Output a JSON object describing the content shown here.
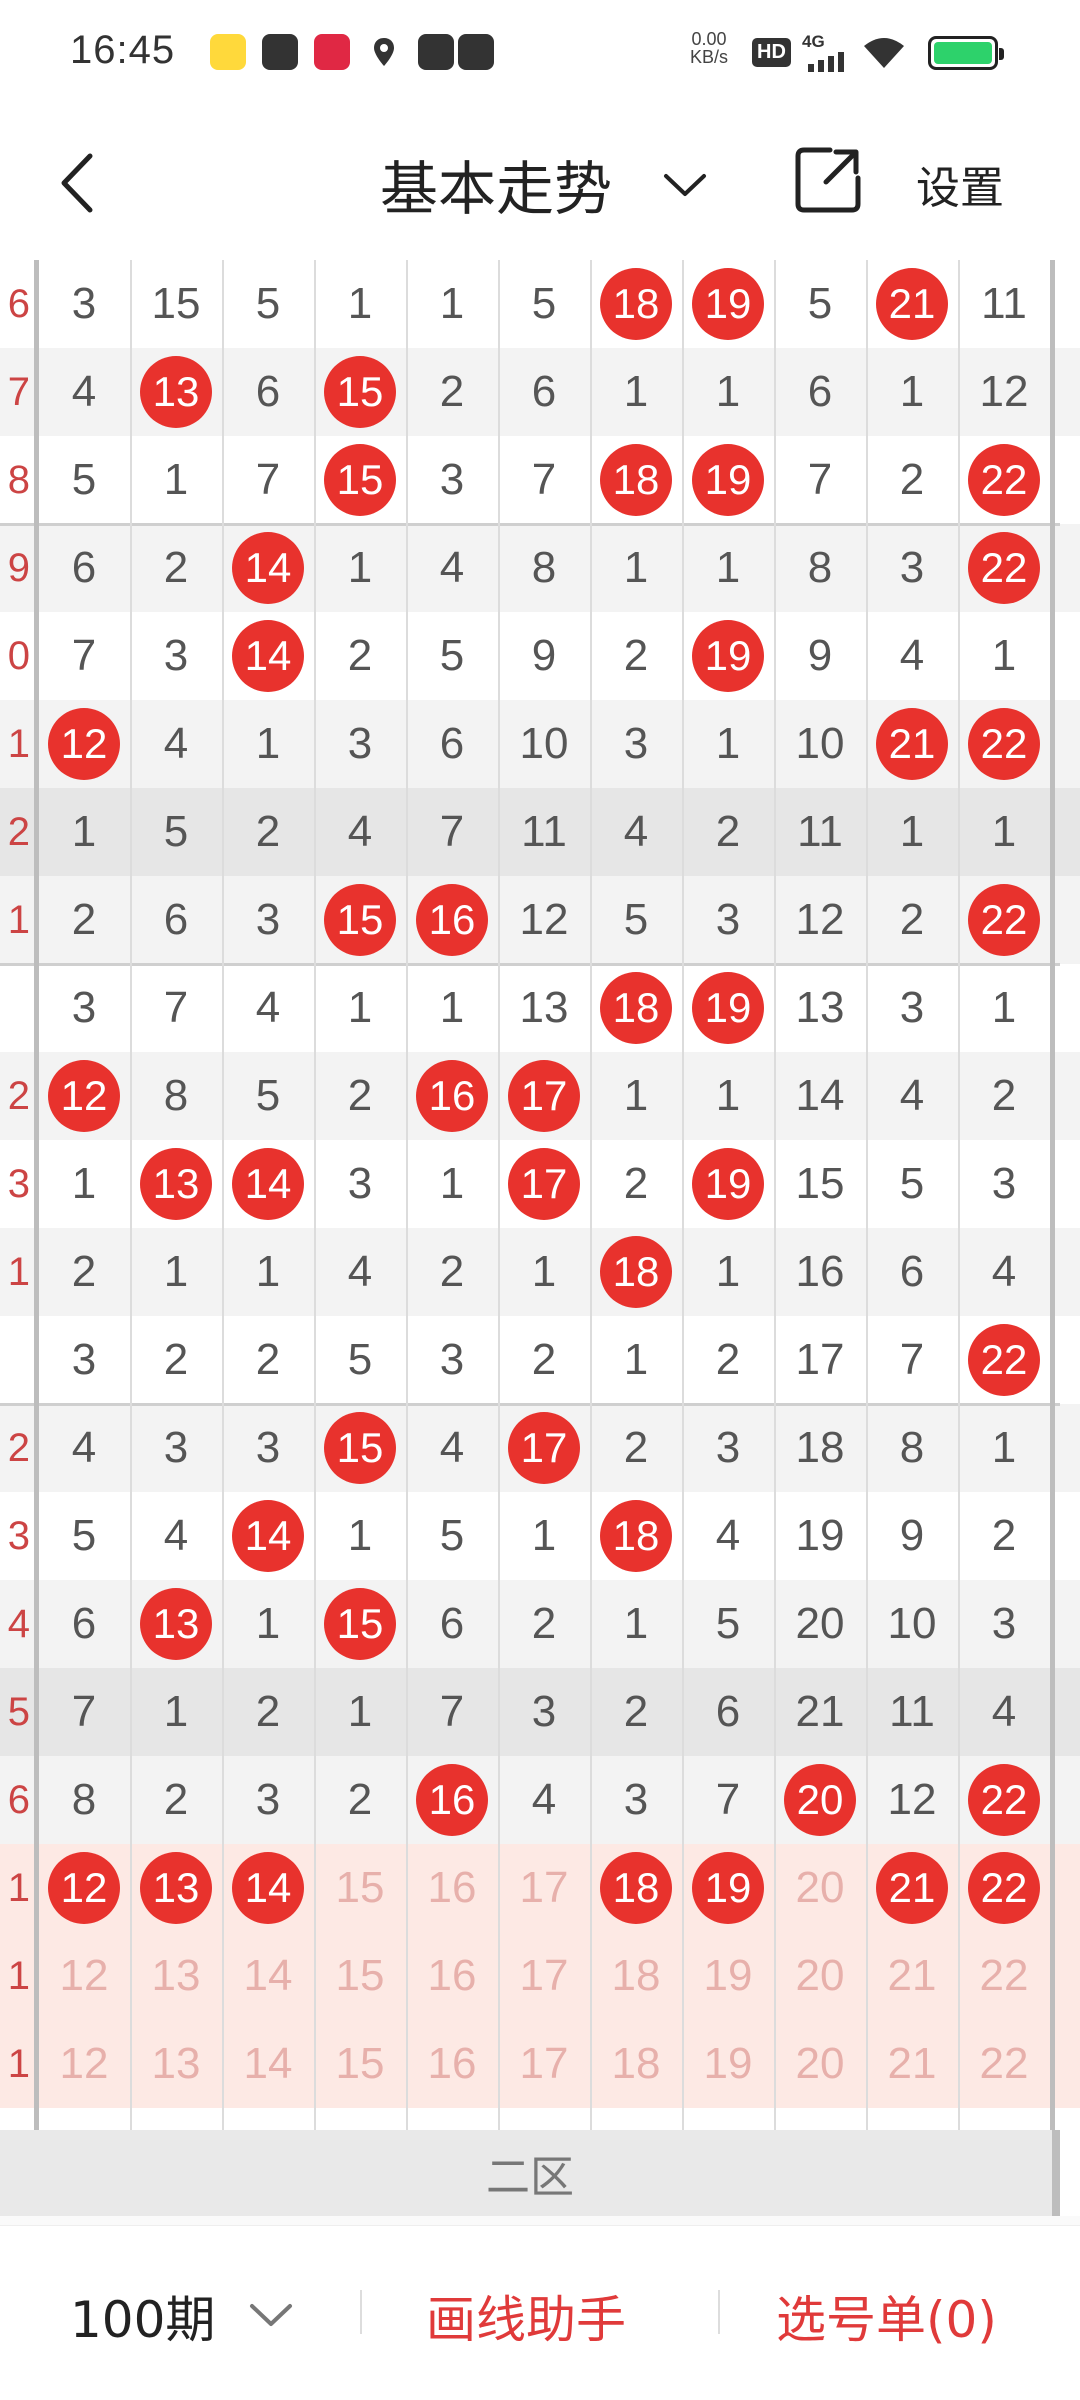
{
  "status_bar": {
    "time": "16:45",
    "network_speed_value": "0.00",
    "network_speed_unit": "KB/s",
    "hd_label": "HD",
    "signal_label": "4G"
  },
  "header": {
    "title": "基本走势",
    "settings_label": "设置"
  },
  "grid": {
    "columns": [
      12,
      13,
      14,
      15,
      16,
      17,
      18,
      19,
      20,
      21,
      22
    ],
    "left_partial_labels": [
      "6",
      "7",
      "8",
      "9",
      "0",
      "1",
      "2",
      "1",
      "",
      "2",
      "3",
      "1",
      "",
      "2",
      "3",
      "4",
      "5",
      "6",
      "1",
      "1",
      "1"
    ],
    "rows": [
      {
        "shade": "none",
        "cells": [
          {
            "v": "3"
          },
          {
            "v": "15"
          },
          {
            "v": "5"
          },
          {
            "v": "1"
          },
          {
            "v": "1"
          },
          {
            "v": "5"
          },
          {
            "v": "18",
            "hit": true
          },
          {
            "v": "19",
            "hit": true
          },
          {
            "v": "5"
          },
          {
            "v": "21",
            "hit": true
          },
          {
            "v": "11"
          }
        ]
      },
      {
        "shade": "light",
        "cells": [
          {
            "v": "4"
          },
          {
            "v": "13",
            "hit": true
          },
          {
            "v": "6"
          },
          {
            "v": "15",
            "hit": true
          },
          {
            "v": "2"
          },
          {
            "v": "6"
          },
          {
            "v": "1"
          },
          {
            "v": "1"
          },
          {
            "v": "6"
          },
          {
            "v": "1"
          },
          {
            "v": "12"
          }
        ]
      },
      {
        "shade": "none",
        "cells": [
          {
            "v": "5"
          },
          {
            "v": "1"
          },
          {
            "v": "7"
          },
          {
            "v": "15",
            "hit": true
          },
          {
            "v": "3"
          },
          {
            "v": "7"
          },
          {
            "v": "18",
            "hit": true
          },
          {
            "v": "19",
            "hit": true
          },
          {
            "v": "7"
          },
          {
            "v": "2"
          },
          {
            "v": "22",
            "hit": true
          }
        ]
      },
      {
        "shade": "light",
        "cells": [
          {
            "v": "6"
          },
          {
            "v": "2"
          },
          {
            "v": "14",
            "hit": true
          },
          {
            "v": "1"
          },
          {
            "v": "4"
          },
          {
            "v": "8"
          },
          {
            "v": "1"
          },
          {
            "v": "1"
          },
          {
            "v": "8"
          },
          {
            "v": "3"
          },
          {
            "v": "22",
            "hit": true
          }
        ]
      },
      {
        "shade": "none",
        "cells": [
          {
            "v": "7"
          },
          {
            "v": "3"
          },
          {
            "v": "14",
            "hit": true
          },
          {
            "v": "2"
          },
          {
            "v": "5"
          },
          {
            "v": "9"
          },
          {
            "v": "2"
          },
          {
            "v": "19",
            "hit": true
          },
          {
            "v": "9"
          },
          {
            "v": "4"
          },
          {
            "v": "1"
          }
        ]
      },
      {
        "shade": "light",
        "cells": [
          {
            "v": "12",
            "hit": true
          },
          {
            "v": "4"
          },
          {
            "v": "1"
          },
          {
            "v": "3"
          },
          {
            "v": "6"
          },
          {
            "v": "10"
          },
          {
            "v": "3"
          },
          {
            "v": "1"
          },
          {
            "v": "10"
          },
          {
            "v": "21",
            "hit": true
          },
          {
            "v": "22",
            "hit": true
          }
        ]
      },
      {
        "shade": "dark",
        "cells": [
          {
            "v": "1"
          },
          {
            "v": "5"
          },
          {
            "v": "2"
          },
          {
            "v": "4"
          },
          {
            "v": "7"
          },
          {
            "v": "11"
          },
          {
            "v": "4"
          },
          {
            "v": "2"
          },
          {
            "v": "11"
          },
          {
            "v": "1"
          },
          {
            "v": "1"
          }
        ]
      },
      {
        "shade": "light",
        "cells": [
          {
            "v": "2"
          },
          {
            "v": "6"
          },
          {
            "v": "3"
          },
          {
            "v": "15",
            "hit": true
          },
          {
            "v": "16",
            "hit": true
          },
          {
            "v": "12"
          },
          {
            "v": "5"
          },
          {
            "v": "3"
          },
          {
            "v": "12"
          },
          {
            "v": "2"
          },
          {
            "v": "22",
            "hit": true
          }
        ]
      },
      {
        "shade": "none",
        "cells": [
          {
            "v": "3"
          },
          {
            "v": "7"
          },
          {
            "v": "4"
          },
          {
            "v": "1"
          },
          {
            "v": "1"
          },
          {
            "v": "13"
          },
          {
            "v": "18",
            "hit": true
          },
          {
            "v": "19",
            "hit": true
          },
          {
            "v": "13"
          },
          {
            "v": "3"
          },
          {
            "v": "1"
          }
        ]
      },
      {
        "shade": "light",
        "cells": [
          {
            "v": "12",
            "hit": true
          },
          {
            "v": "8"
          },
          {
            "v": "5"
          },
          {
            "v": "2"
          },
          {
            "v": "16",
            "hit": true
          },
          {
            "v": "17",
            "hit": true
          },
          {
            "v": "1"
          },
          {
            "v": "1"
          },
          {
            "v": "14"
          },
          {
            "v": "4"
          },
          {
            "v": "2"
          }
        ]
      },
      {
        "shade": "none",
        "cells": [
          {
            "v": "1"
          },
          {
            "v": "13",
            "hit": true
          },
          {
            "v": "14",
            "hit": true
          },
          {
            "v": "3"
          },
          {
            "v": "1"
          },
          {
            "v": "17",
            "hit": true
          },
          {
            "v": "2"
          },
          {
            "v": "19",
            "hit": true
          },
          {
            "v": "15"
          },
          {
            "v": "5"
          },
          {
            "v": "3"
          }
        ]
      },
      {
        "shade": "light",
        "cells": [
          {
            "v": "2"
          },
          {
            "v": "1"
          },
          {
            "v": "1"
          },
          {
            "v": "4"
          },
          {
            "v": "2"
          },
          {
            "v": "1"
          },
          {
            "v": "18",
            "hit": true
          },
          {
            "v": "1"
          },
          {
            "v": "16"
          },
          {
            "v": "6"
          },
          {
            "v": "4"
          }
        ]
      },
      {
        "shade": "none",
        "cells": [
          {
            "v": "3"
          },
          {
            "v": "2"
          },
          {
            "v": "2"
          },
          {
            "v": "5"
          },
          {
            "v": "3"
          },
          {
            "v": "2"
          },
          {
            "v": "1"
          },
          {
            "v": "2"
          },
          {
            "v": "17"
          },
          {
            "v": "7"
          },
          {
            "v": "22",
            "hit": true
          }
        ]
      },
      {
        "shade": "light",
        "cells": [
          {
            "v": "4"
          },
          {
            "v": "3"
          },
          {
            "v": "3"
          },
          {
            "v": "15",
            "hit": true
          },
          {
            "v": "4"
          },
          {
            "v": "17",
            "hit": true
          },
          {
            "v": "2"
          },
          {
            "v": "3"
          },
          {
            "v": "18"
          },
          {
            "v": "8"
          },
          {
            "v": "1"
          }
        ]
      },
      {
        "shade": "none",
        "cells": [
          {
            "v": "5"
          },
          {
            "v": "4"
          },
          {
            "v": "14",
            "hit": true
          },
          {
            "v": "1"
          },
          {
            "v": "5"
          },
          {
            "v": "1"
          },
          {
            "v": "18",
            "hit": true
          },
          {
            "v": "4"
          },
          {
            "v": "19"
          },
          {
            "v": "9"
          },
          {
            "v": "2"
          }
        ]
      },
      {
        "shade": "light",
        "cells": [
          {
            "v": "6"
          },
          {
            "v": "13",
            "hit": true
          },
          {
            "v": "1"
          },
          {
            "v": "15",
            "hit": true
          },
          {
            "v": "6"
          },
          {
            "v": "2"
          },
          {
            "v": "1"
          },
          {
            "v": "5"
          },
          {
            "v": "20"
          },
          {
            "v": "10"
          },
          {
            "v": "3"
          }
        ]
      },
      {
        "shade": "dark",
        "cells": [
          {
            "v": "7"
          },
          {
            "v": "1"
          },
          {
            "v": "2"
          },
          {
            "v": "1"
          },
          {
            "v": "7"
          },
          {
            "v": "3"
          },
          {
            "v": "2"
          },
          {
            "v": "6"
          },
          {
            "v": "21"
          },
          {
            "v": "11"
          },
          {
            "v": "4"
          }
        ]
      },
      {
        "shade": "light",
        "cells": [
          {
            "v": "8"
          },
          {
            "v": "2"
          },
          {
            "v": "3"
          },
          {
            "v": "2"
          },
          {
            "v": "16",
            "hit": true
          },
          {
            "v": "4"
          },
          {
            "v": "3"
          },
          {
            "v": "7"
          },
          {
            "v": "20",
            "hit": true
          },
          {
            "v": "12"
          },
          {
            "v": "22",
            "hit": true
          }
        ]
      },
      {
        "shade": "pink",
        "cells": [
          {
            "v": "12",
            "hit": true
          },
          {
            "v": "13",
            "hit": true
          },
          {
            "v": "14",
            "hit": true
          },
          {
            "v": "15",
            "pale": true
          },
          {
            "v": "16",
            "pale": true
          },
          {
            "v": "17",
            "pale": true
          },
          {
            "v": "18",
            "hit": true
          },
          {
            "v": "19",
            "hit": true
          },
          {
            "v": "20",
            "pale": true
          },
          {
            "v": "21",
            "hit": true
          },
          {
            "v": "22",
            "hit": true
          }
        ]
      },
      {
        "shade": "pink",
        "cells": [
          {
            "v": "12",
            "pale": true
          },
          {
            "v": "13",
            "pale": true
          },
          {
            "v": "14",
            "pale": true
          },
          {
            "v": "15",
            "pale": true
          },
          {
            "v": "16",
            "pale": true
          },
          {
            "v": "17",
            "pale": true
          },
          {
            "v": "18",
            "pale": true
          },
          {
            "v": "19",
            "pale": true
          },
          {
            "v": "20",
            "pale": true
          },
          {
            "v": "21",
            "pale": true
          },
          {
            "v": "22",
            "pale": true
          }
        ]
      },
      {
        "shade": "pink",
        "cells": [
          {
            "v": "12",
            "pale": true
          },
          {
            "v": "13",
            "pale": true
          },
          {
            "v": "14",
            "pale": true
          },
          {
            "v": "15",
            "pale": true
          },
          {
            "v": "16",
            "pale": true
          },
          {
            "v": "17",
            "pale": true
          },
          {
            "v": "18",
            "pale": true
          },
          {
            "v": "19",
            "pale": true
          },
          {
            "v": "20",
            "pale": true
          },
          {
            "v": "21",
            "pale": true
          },
          {
            "v": "22",
            "pale": true
          }
        ]
      }
    ],
    "zone_label": "二区",
    "colors": {
      "hit_ball": "#e8322d",
      "pale_text": "#e7b0ab",
      "pink_row": "#fde9e4"
    }
  },
  "bottom_bar": {
    "period_label": "100期",
    "draw_line_label": "画线助手",
    "pick_list_label": "选号单(0)"
  }
}
